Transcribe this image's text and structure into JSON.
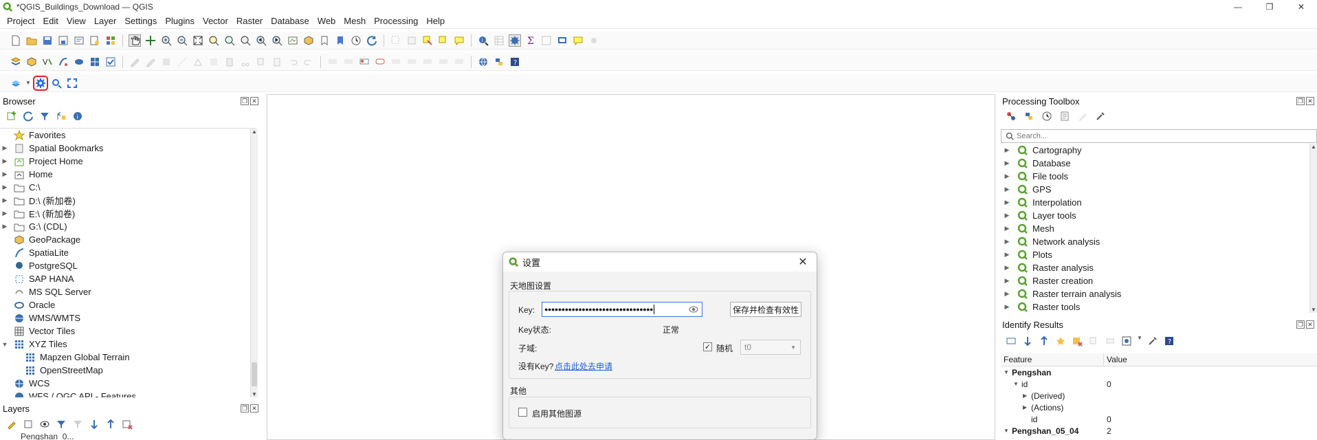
{
  "window": {
    "title": "*QGIS_Buildings_Download — QGIS",
    "minimize": "—",
    "restore": "❐",
    "close": "✕"
  },
  "menu": [
    "Project",
    "Edit",
    "View",
    "Layer",
    "Settings",
    "Plugins",
    "Vector",
    "Raster",
    "Database",
    "Web",
    "Mesh",
    "Processing",
    "Help"
  ],
  "browser": {
    "title": "Browser",
    "items": [
      {
        "label": "Favorites",
        "icon": "star-icon",
        "arrow": ""
      },
      {
        "label": "Spatial Bookmarks",
        "icon": "bookmark-icon",
        "arrow": "▶"
      },
      {
        "label": "Project Home",
        "icon": "project-home-icon",
        "arrow": "▶"
      },
      {
        "label": "Home",
        "icon": "home-folder-icon",
        "arrow": "▶"
      },
      {
        "label": "C:\\",
        "icon": "folder-icon",
        "arrow": "▶"
      },
      {
        "label": "D:\\ (新加卷)",
        "icon": "folder-icon",
        "arrow": "▶"
      },
      {
        "label": "E:\\ (新加卷)",
        "icon": "folder-icon",
        "arrow": "▶"
      },
      {
        "label": "G:\\ (CDL)",
        "icon": "folder-icon",
        "arrow": "▶"
      },
      {
        "label": "GeoPackage",
        "icon": "geopackage-icon",
        "arrow": ""
      },
      {
        "label": "SpatiaLite",
        "icon": "spatialite-icon",
        "arrow": ""
      },
      {
        "label": "PostgreSQL",
        "icon": "postgresql-icon",
        "arrow": ""
      },
      {
        "label": "SAP HANA",
        "icon": "sap-hana-icon",
        "arrow": ""
      },
      {
        "label": "MS SQL Server",
        "icon": "mssql-icon",
        "arrow": ""
      },
      {
        "label": "Oracle",
        "icon": "oracle-icon",
        "arrow": ""
      },
      {
        "label": "WMS/WMTS",
        "icon": "wms-icon",
        "arrow": ""
      },
      {
        "label": "Vector Tiles",
        "icon": "vector-tiles-icon",
        "arrow": ""
      },
      {
        "label": "XYZ Tiles",
        "icon": "xyz-tiles-icon",
        "arrow": "▼"
      },
      {
        "label": "Mapzen Global Terrain",
        "icon": "xyz-tiles-icon",
        "arrow": "",
        "indent": true
      },
      {
        "label": "OpenStreetMap",
        "icon": "xyz-tiles-icon",
        "arrow": "",
        "indent": true
      },
      {
        "label": "WCS",
        "icon": "wcs-icon",
        "arrow": ""
      },
      {
        "label": "WFS / OGC API - Features",
        "icon": "wfs-icon",
        "arrow": ""
      }
    ]
  },
  "layers": {
    "title": "Layers",
    "partial_item": "Pengshan_0..."
  },
  "processing": {
    "title": "Processing Toolbox",
    "search_placeholder": "Search...",
    "items": [
      "Cartography",
      "Database",
      "File tools",
      "GPS",
      "Interpolation",
      "Layer tools",
      "Mesh",
      "Network analysis",
      "Plots",
      "Raster analysis",
      "Raster creation",
      "Raster terrain analysis",
      "Raster tools"
    ]
  },
  "identify": {
    "title": "Identify Results",
    "col_feature": "Feature",
    "col_value": "Value",
    "rows": [
      {
        "feature": "Pengshan",
        "value": "",
        "level": 0,
        "arrow": "▼",
        "bold": true
      },
      {
        "feature": "id",
        "value": "0",
        "level": 1,
        "arrow": "▼",
        "bold": false
      },
      {
        "feature": "(Derived)",
        "value": "",
        "level": 2,
        "arrow": "▶",
        "bold": false
      },
      {
        "feature": "(Actions)",
        "value": "",
        "level": 2,
        "arrow": "▶",
        "bold": false
      },
      {
        "feature": "id",
        "value": "0",
        "level": 2,
        "arrow": "",
        "bold": false
      },
      {
        "feature": "Pengshan_05_04",
        "value": "2",
        "level": 0,
        "arrow": "▼",
        "bold": true
      }
    ]
  },
  "dialog": {
    "title": "设置",
    "group_tianditu": "天地图设置",
    "key_label": "Key:",
    "key_value": "●●●●●●●●●●●●●●●●●●●●●●●●●●●●●●●●",
    "save_button": "保存并检查有效性",
    "key_status_label": "Key状态:",
    "key_status_value": "正常",
    "subdomain_label": "子域:",
    "random_label": "随机",
    "random_checked": true,
    "subdomain_value": "t0",
    "no_key_text": "没有Key?",
    "apply_link": "点击此处去申请",
    "group_other": "其他",
    "enable_other_label": "启用其他图源",
    "enable_other_checked": false
  },
  "colors": {
    "accent": "#3874d8",
    "highlight": "#e02020",
    "qgis_green": "#5aa22f"
  }
}
